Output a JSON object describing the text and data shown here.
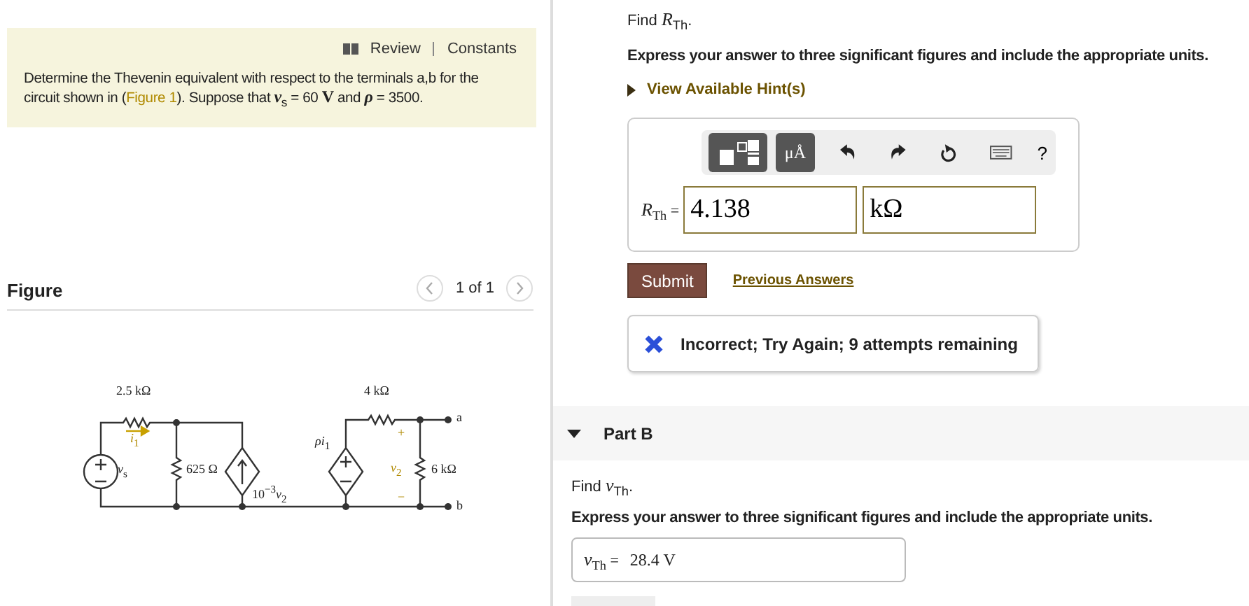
{
  "info": {
    "links": [
      "Review",
      "Constants"
    ],
    "problem": {
      "before": "Determine the Thevenin equivalent with respect to the terminals a,b for the circuit shown in (",
      "link": "Figure 1",
      "after": "). Suppose that *v*$_{s}$ = 60 **V** and *ρ* = 3500."
    }
  },
  "figure": {
    "title": "Figure",
    "pager": "1 of 1",
    "labels": [
      "2.5 kΩ",
      "*i*$_{1}$",
      "*v*$_{s}$",
      "625 Ω",
      "10$^{−3}$*v*$_{2}$",
      "*ρi*$_{1}$",
      "4 kΩ",
      "+",
      "*v*$_{2}$",
      "6 kΩ",
      "−",
      "a",
      "b"
    ]
  },
  "part_a": {
    "find": "Find *R*$_{Th}$.",
    "instruction": "Express your answer to three significant figures and include the appropriate units.",
    "hint": "View Available Hint(s)",
    "units_button": "μÅ",
    "help_button": "?",
    "answer_label": "*R*$_{Th}$ =",
    "value": "4.138",
    "unit": "kΩ",
    "submit": "Submit",
    "previous": "Previous Answers",
    "feedback": {
      "kind": "incorrect",
      "text": "Incorrect; Try Again; 9 attempts remaining"
    }
  },
  "part_b": {
    "title": "Part B",
    "expanded": true,
    "find": "Find *v*$_{Th}$.",
    "instruction": "Express your answer to three significant figures and include the appropriate units.",
    "answer_label": "*v*$_{Th}$ =",
    "value": "28.4 V"
  }
}
